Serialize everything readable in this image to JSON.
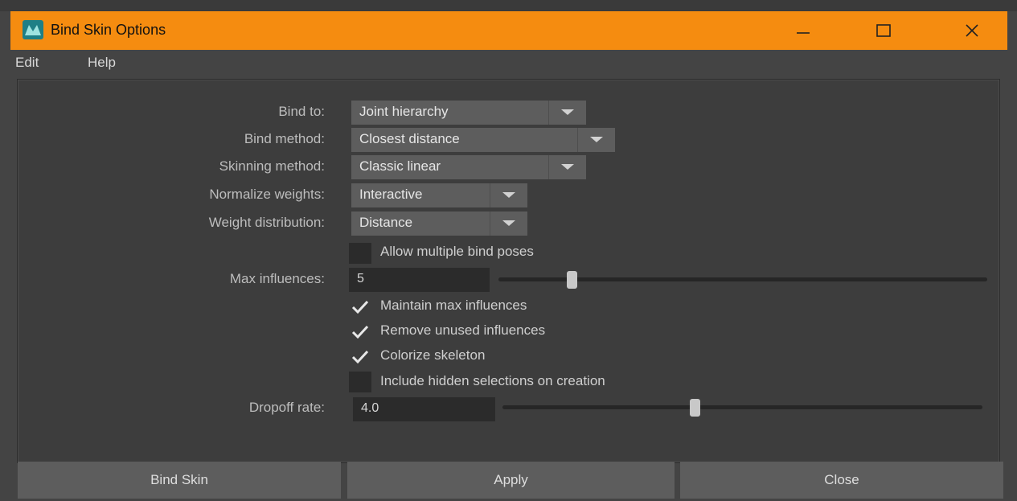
{
  "window": {
    "title": "Bind Skin Options",
    "accent_color": "#f58c10",
    "controls": {
      "minimize_icon": "minimize-icon",
      "maximize_icon": "maximize-icon",
      "close_icon": "close-icon"
    }
  },
  "menu": {
    "items": [
      "Edit",
      "Help"
    ]
  },
  "form": {
    "bind_to": {
      "label": "Bind to:",
      "value": "Joint hierarchy"
    },
    "bind_method": {
      "label": "Bind method:",
      "value": "Closest distance"
    },
    "skinning_method": {
      "label": "Skinning method:",
      "value": "Classic linear"
    },
    "normalize_weights": {
      "label": "Normalize weights:",
      "value": "Interactive"
    },
    "weight_distribution": {
      "label": "Weight distribution:",
      "value": "Distance"
    },
    "allow_multiple_bind_poses": {
      "label": "Allow multiple bind poses",
      "checked": false
    },
    "max_influences": {
      "label": "Max influences:",
      "value": "5",
      "slider_fraction": 0.15
    },
    "maintain_max_influences": {
      "label": "Maintain max influences",
      "checked": true
    },
    "remove_unused_influences": {
      "label": "Remove unused influences",
      "checked": true
    },
    "colorize_skeleton": {
      "label": "Colorize skeleton",
      "checked": true
    },
    "include_hidden_selections": {
      "label": "Include hidden selections on creation",
      "checked": false
    },
    "dropoff_rate": {
      "label": "Dropoff rate:",
      "value": "4.0",
      "slider_fraction": 0.4
    }
  },
  "buttons": {
    "bind_skin": "Bind Skin",
    "apply": "Apply",
    "close": "Close"
  }
}
